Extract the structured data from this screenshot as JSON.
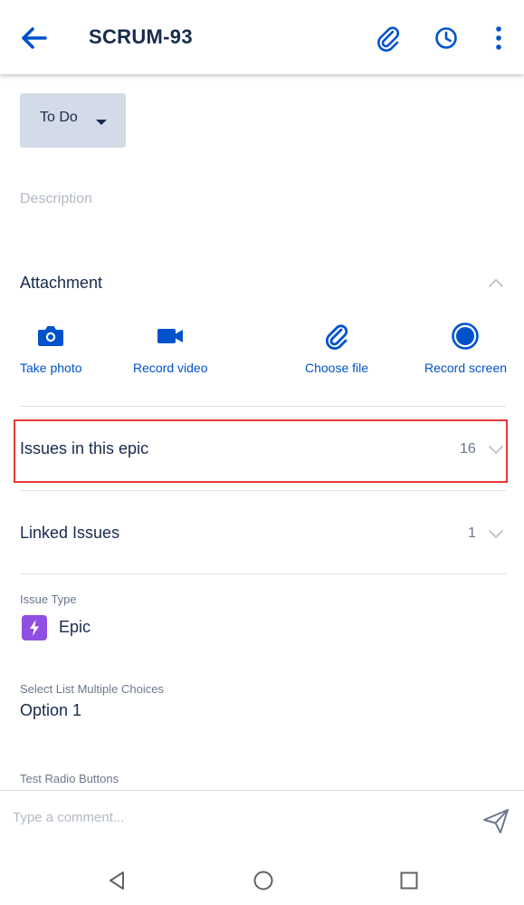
{
  "header": {
    "title": "SCRUM-93",
    "icons": [
      "back-arrow-icon",
      "paperclip-icon",
      "clock-icon",
      "more-vert-icon"
    ]
  },
  "status": {
    "label": "To Do"
  },
  "description": {
    "placeholder": "Description"
  },
  "attachment": {
    "title": "Attachment",
    "options": [
      {
        "label": "Take photo",
        "icon": "camera-icon"
      },
      {
        "label": "Record video",
        "icon": "video-camera-icon"
      },
      {
        "label": "Choose file",
        "icon": "paperclip-icon"
      },
      {
        "label": "Record screen",
        "icon": "record-icon"
      }
    ]
  },
  "issues_in_epic": {
    "label": "Issues in this epic",
    "count": "16"
  },
  "linked_issues": {
    "label": "Linked Issues",
    "count": "1"
  },
  "fields": {
    "issue_type": {
      "label": "Issue Type",
      "value": "Epic",
      "icon": "lightning-icon"
    },
    "select_list": {
      "label": "Select List Multiple Choices",
      "value": "Option 1"
    },
    "radio": {
      "label": "Test Radio Buttons"
    }
  },
  "comment": {
    "placeholder": "Type a comment..."
  },
  "colors": {
    "accent": "#0052cc",
    "epic": "#904ee2",
    "highlight": "#e53935"
  },
  "nav": {
    "icons": [
      "back-triangle-icon",
      "home-circle-icon",
      "recents-square-icon"
    ]
  }
}
